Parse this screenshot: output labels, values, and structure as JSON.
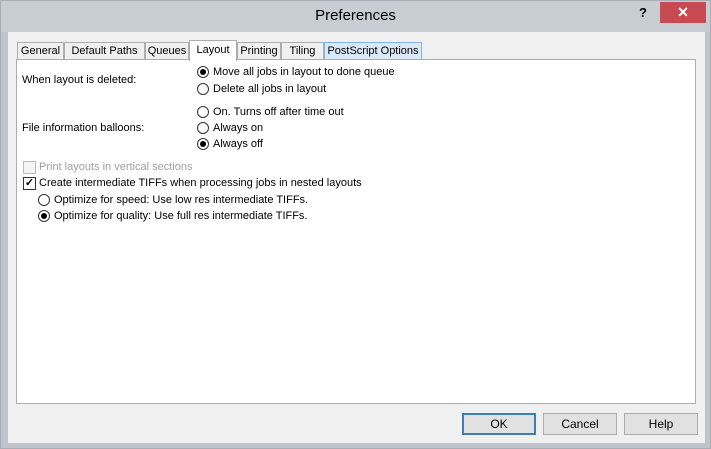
{
  "window": {
    "title": "Preferences",
    "help_glyph": "?",
    "close_glyph": "✕"
  },
  "tabs": [
    {
      "label": "General"
    },
    {
      "label": "Default Paths"
    },
    {
      "label": "Queues"
    },
    {
      "label": "Layout",
      "active": true
    },
    {
      "label": "Printing"
    },
    {
      "label": "Tiling"
    },
    {
      "label": "PostScript Options"
    }
  ],
  "layout_tab": {
    "layout_deleted": {
      "label": "When layout is deleted:",
      "options": [
        {
          "label": "Move all jobs in layout to done queue",
          "checked": true
        },
        {
          "label": "Delete all jobs in layout",
          "checked": false
        }
      ]
    },
    "file_info_balloons": {
      "label": "File information balloons:",
      "options": [
        {
          "label": "On.  Turns off after time out",
          "checked": false
        },
        {
          "label": "Always on",
          "checked": false
        },
        {
          "label": "Always off",
          "checked": true
        }
      ]
    },
    "print_vertical_sections": {
      "label": "Print layouts in vertical sections",
      "checked": false,
      "enabled": false
    },
    "create_intermediate_tiffs": {
      "label": "Create intermediate TIFFs when processing jobs in nested layouts",
      "checked": true,
      "check_glyph": "✓",
      "options": [
        {
          "label": "Optimize for speed: Use low res intermediate TIFFs.",
          "checked": false
        },
        {
          "label": "Optimize for quality: Use full res intermediate TIFFs.",
          "checked": true
        }
      ]
    }
  },
  "buttons": {
    "ok": "OK",
    "cancel": "Cancel",
    "help": "Help"
  },
  "colors": {
    "close_button": "#c74b50",
    "window_frame": "#bfc4cc",
    "default_button_border": "#3c7fb1"
  }
}
